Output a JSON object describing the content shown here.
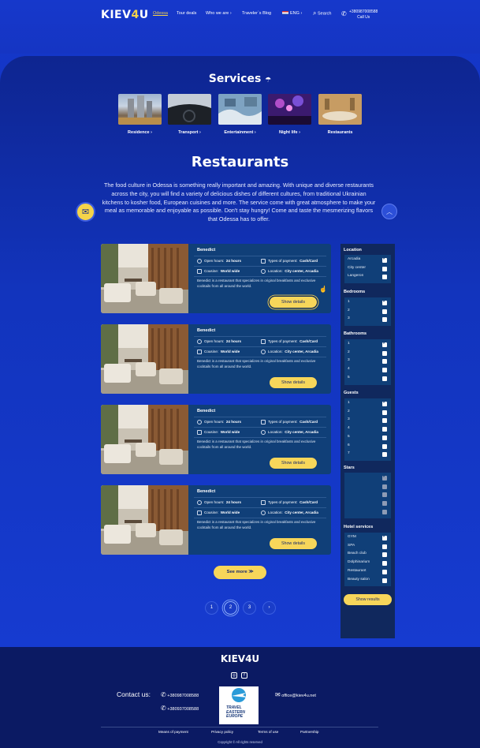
{
  "header": {
    "logo": "KIEV4U",
    "nav": [
      "Odessa",
      "Tour deals",
      "Who we are",
      "Traveler`s Blog",
      "ENG",
      "Search"
    ],
    "phone": "+380987008588",
    "call_us": "Call Us"
  },
  "services": {
    "title": "Services",
    "items": [
      {
        "label": "Residence",
        "chevron": true
      },
      {
        "label": "Transport",
        "chevron": true
      },
      {
        "label": "Entertainment",
        "chevron": true
      },
      {
        "label": "Night life",
        "chevron": true
      },
      {
        "label": "Restaurants",
        "chevron": false
      }
    ]
  },
  "restaurants": {
    "title": "Restaurants",
    "intro": "The food culture in Odessa is something really important and amazing. With unique and diverse restaurants across the city, you will find a variety of delicious dishes of different cultures, from traditional Ukrainian kitchens to kosher food, European cuisines and more. The service come with great atmosphere to make your meal as memorable and enjoyable as possible. Don't stay hungry! Come and taste the mesmerizing flavors that Odessa has to offer."
  },
  "cards": [
    {
      "name": "Benedict",
      "open_label": "Open hours:",
      "open": "24 hours",
      "pay_label": "Types of payment:",
      "pay": "Cash/Card",
      "cuisine_label": "Cousine:",
      "cuisine": "World wide",
      "loc_label": "Location:",
      "loc": "City center, Arcadia",
      "desc": "Benedict is a restaurant that specializes in original breakfasts and exclusive cocktails from all around the world.",
      "button": "Show details"
    },
    {
      "name": "Benedict",
      "open_label": "Open hours:",
      "open": "24 hours",
      "pay_label": "Types of payment:",
      "pay": "Cash/Card",
      "cuisine_label": "Cousine:",
      "cuisine": "World wide",
      "loc_label": "Location:",
      "loc": "City center, Arcadia",
      "desc": "Benedict is a restaurant that specializes in original breakfasts and exclusive cocktails from all around the world.",
      "button": "Show details"
    },
    {
      "name": "Benedict",
      "open_label": "Open hours:",
      "open": "24 hours",
      "pay_label": "Types of payment:",
      "pay": "Cash/Card",
      "cuisine_label": "Cousine:",
      "cuisine": "World wide",
      "loc_label": "Location:",
      "loc": "City center, Arcadia",
      "desc": "Benedict is a restaurant that specializes in original breakfasts and exclusive cocktails from all around the world.",
      "button": "Show details"
    },
    {
      "name": "Benedict",
      "open_label": "Open hours:",
      "open": "24 hours",
      "pay_label": "Types of payment:",
      "pay": "Cash/Card",
      "cuisine_label": "Cousine:",
      "cuisine": "World wide",
      "loc_label": "Location:",
      "loc": "City center, Arcadia",
      "desc": "Benedict is a restaurant that specializes in original breakfasts and exclusive cocktails from all around the world.",
      "button": "Show details"
    }
  ],
  "see_more": "See more",
  "pagination": [
    "1",
    "2",
    "3"
  ],
  "filters": {
    "location": {
      "title": "Location",
      "options": [
        "Arcadia",
        "City center",
        "Langeron"
      ],
      "checked": [
        true,
        false,
        false
      ]
    },
    "bedrooms": {
      "title": "Bedrooms",
      "options": [
        "1",
        "2",
        "3"
      ],
      "checked": [
        true,
        false,
        false
      ]
    },
    "bathrooms": {
      "title": "Bathrooms",
      "options": [
        "1",
        "2",
        "3",
        "4",
        "5"
      ],
      "checked": [
        true,
        false,
        false,
        false,
        false
      ]
    },
    "guests": {
      "title": "Guests",
      "options": [
        "1",
        "2",
        "3",
        "4",
        "5",
        "6",
        "7"
      ],
      "checked": [
        true,
        false,
        false,
        false,
        false,
        false,
        false
      ]
    },
    "stars": {
      "title": "Stars",
      "checked": [
        true,
        false,
        false,
        false,
        false
      ]
    },
    "hotel_services": {
      "title": "Hotel services",
      "options": [
        "GYM",
        "SPA",
        "Beach club",
        "Dolphinarium",
        "Restaurant",
        "Beauty salon"
      ],
      "checked": [
        true,
        false,
        false,
        false,
        false,
        false
      ]
    },
    "button": "Show results"
  },
  "footer": {
    "logo": "KIEV4U",
    "contact_label": "Contact us:",
    "phones": [
      "+380987008588",
      "+380937008588"
    ],
    "email": "office@kiev4u.net",
    "badge": [
      "TRAVEL",
      "EASTERN",
      "EUROPE"
    ],
    "links": [
      "Means of payment",
      "Privacy policy",
      "Terms of use",
      "Partnership"
    ],
    "copyright": "Copyright © All rights reserved"
  },
  "colors": {
    "accent": "#f7d65a",
    "card": "#103f78",
    "sidebar": "#10285d",
    "footer": "#0b1a63"
  }
}
